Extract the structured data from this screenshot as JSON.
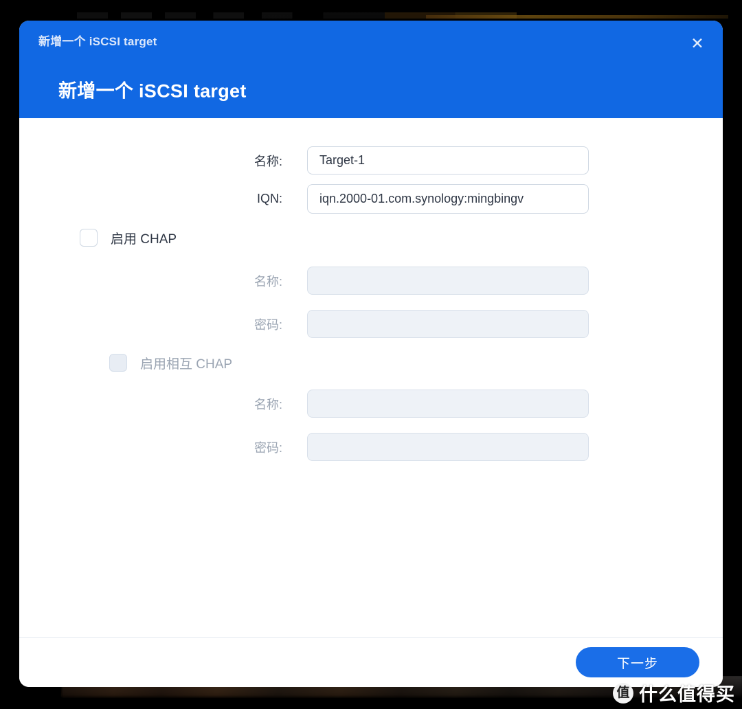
{
  "dialog": {
    "header_small_title": "新增一个 iSCSI target",
    "header_title": "新增一个 iSCSI target",
    "close_icon": "✕",
    "accent_color": "#1168e3",
    "button_color": "#1a6ee8"
  },
  "form": {
    "name_label": "名称:",
    "name_value": "Target-1",
    "iqn_label": "IQN:",
    "iqn_value": "iqn.2000-01.com.synology:mingbingv",
    "enable_chap_label": "启用 CHAP",
    "chap_name_label": "名称:",
    "chap_name_value": "",
    "chap_password_label": "密码:",
    "chap_password_value": "",
    "enable_mutual_chap_label": "启用相互 CHAP",
    "mutual_name_label": "名称:",
    "mutual_name_value": "",
    "mutual_password_label": "密码:",
    "mutual_password_value": ""
  },
  "footer": {
    "next_button": "下一步"
  },
  "watermark": {
    "logo_char": "值",
    "text": "什么值得买"
  }
}
